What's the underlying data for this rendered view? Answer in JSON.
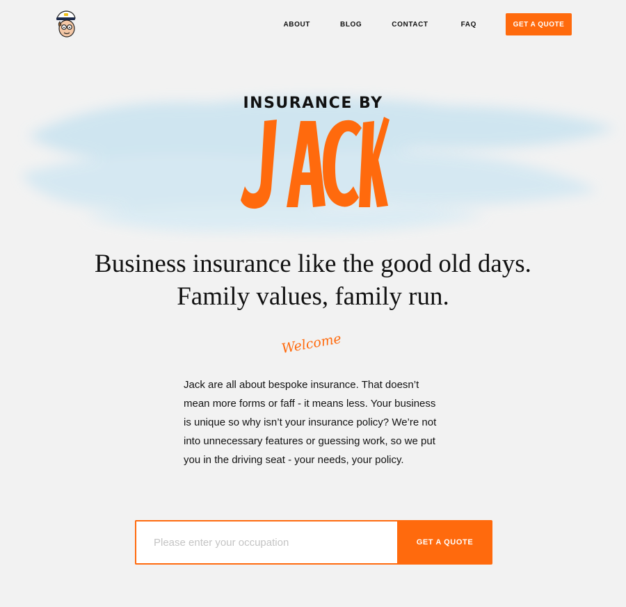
{
  "header": {
    "logo_icon": "captain-jack-face-icon",
    "nav": {
      "about": "ABOUT",
      "blog": "BLOG",
      "contact": "CONTACT",
      "faq": "FAQ"
    },
    "quote_button": "GET A QUOTE"
  },
  "hero": {
    "brand_top": "INSURANCE BY",
    "brand_name": "JACK",
    "headline_line1": "Business insurance like the good old days.",
    "headline_line2": "Family values, family run.",
    "welcome": "Welcome",
    "intro": "Jack are all about bespoke insurance. That doesn’t mean more forms or faff - it means less. Your business is unique so why isn’t your insurance policy? We’re not into unnecessary features or guessing work, so we put you in the driving seat - your needs, your policy."
  },
  "signup": {
    "placeholder": "Please enter your occupation",
    "value": "",
    "button": "GET A QUOTE"
  },
  "colors": {
    "accent": "#ff6a0d",
    "background": "#f2f2f2",
    "wash": "#cfe6f2"
  }
}
